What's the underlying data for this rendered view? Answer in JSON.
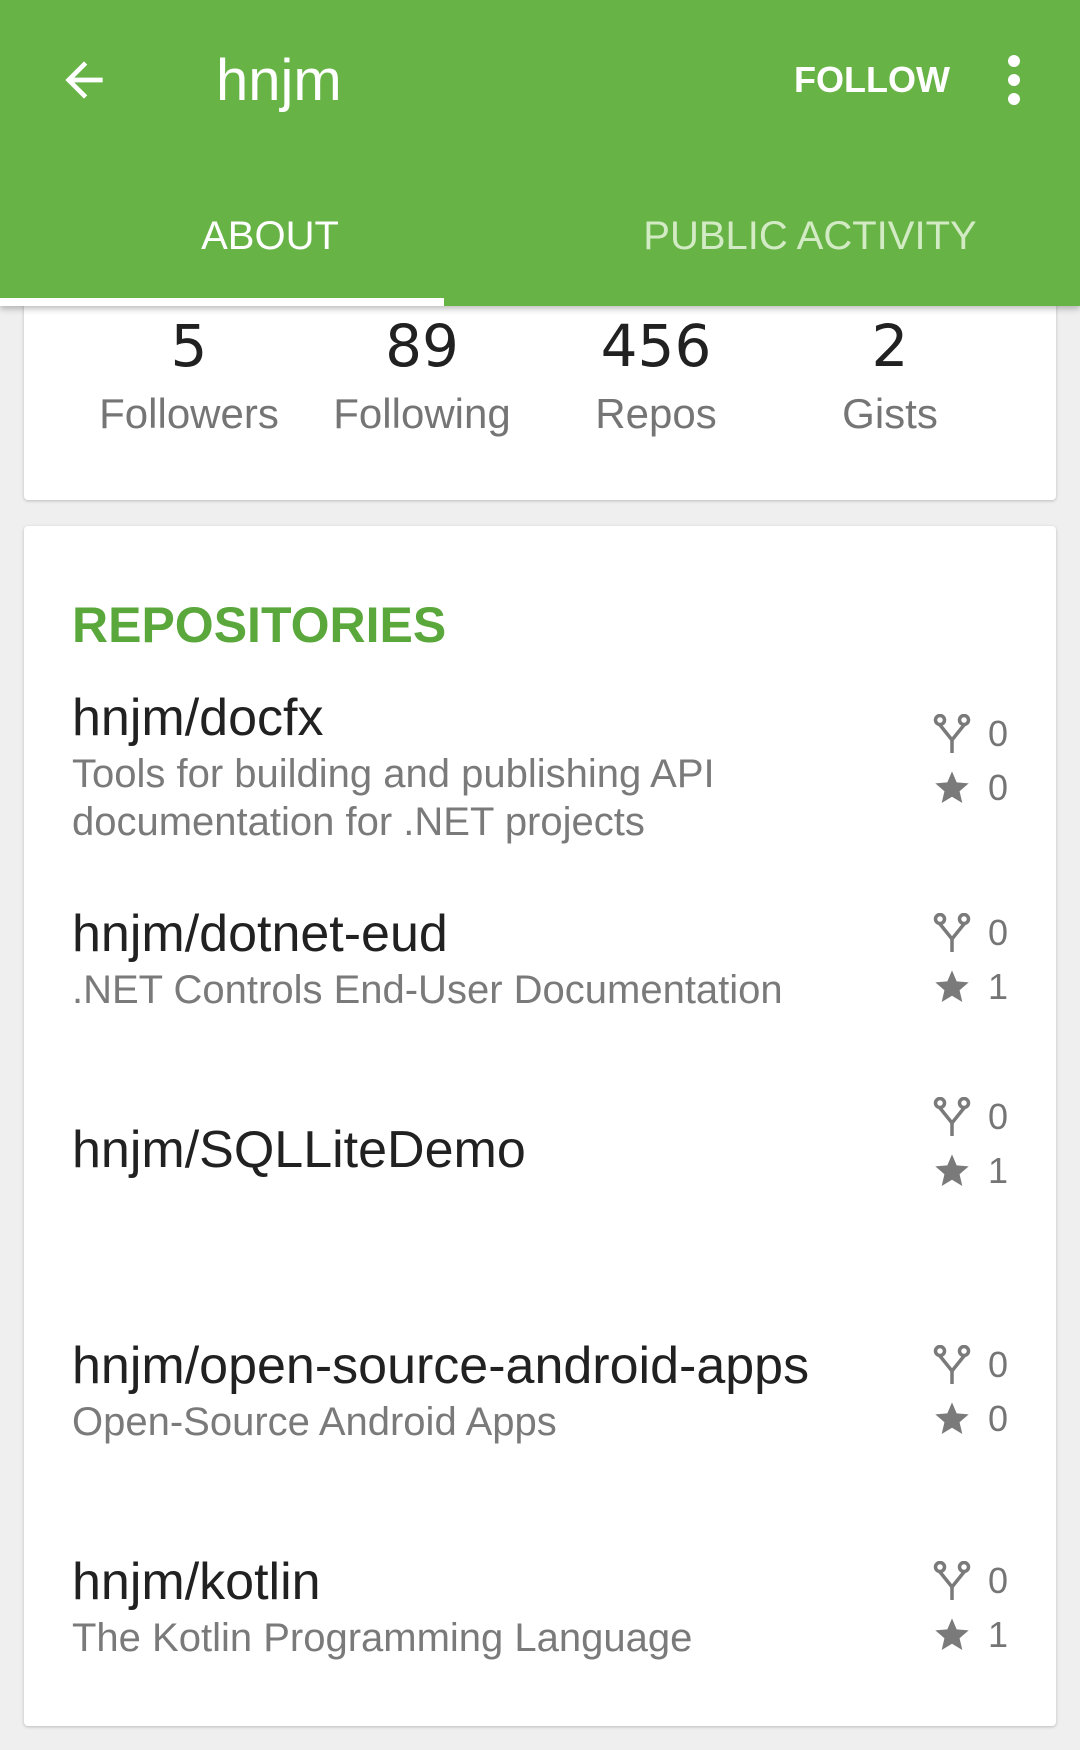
{
  "app_bar": {
    "title": "hnjm",
    "follow_label": "FOLLOW",
    "background_color": "#67b346"
  },
  "tabs": [
    {
      "label": "ABOUT",
      "active": true
    },
    {
      "label": "PUBLIC ACTIVITY",
      "active": false
    }
  ],
  "stats": [
    {
      "value": "5",
      "label": "Followers"
    },
    {
      "value": "89",
      "label": "Following"
    },
    {
      "value": "456",
      "label": "Repos"
    },
    {
      "value": "2",
      "label": "Gists"
    }
  ],
  "repositories": {
    "title": "REPOSITORIES",
    "items": [
      {
        "name": "hnjm/docfx",
        "description": "Tools for building and publishing API documentation for .NET projects",
        "forks": "0",
        "stars": "0"
      },
      {
        "name": "hnjm/dotnet-eud",
        "description": ".NET Controls End-User Documentation",
        "forks": "0",
        "stars": "1"
      },
      {
        "name": "hnjm/SQLLiteDemo",
        "description": "",
        "forks": "0",
        "stars": "1"
      },
      {
        "name": "hnjm/open-source-android-apps",
        "description": "Open-Source Android Apps",
        "forks": "0",
        "stars": "0"
      },
      {
        "name": "hnjm/kotlin",
        "description": "The Kotlin Programming Language",
        "forks": "0",
        "stars": "1"
      }
    ]
  },
  "icons": {
    "back": "arrow-left-icon",
    "overflow": "more-vertical-icon",
    "fork": "fork-icon",
    "star": "star-icon"
  }
}
